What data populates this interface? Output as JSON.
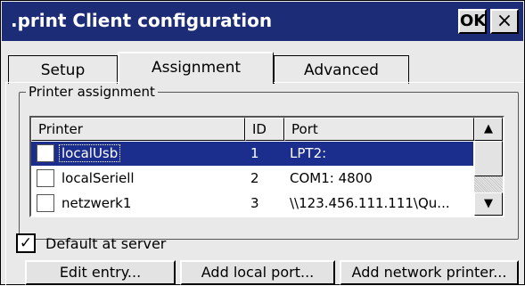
{
  "window": {
    "title": ".print Client configuration",
    "ok_label": "OK",
    "close_label": "×"
  },
  "tabs": [
    {
      "label": "Setup"
    },
    {
      "label": "Assignment"
    },
    {
      "label": "Advanced"
    }
  ],
  "group": {
    "label": "Printer assignment"
  },
  "list": {
    "columns": [
      "Printer",
      "ID",
      "Port"
    ],
    "rows": [
      {
        "printer": "localUsb",
        "id": "1",
        "port": "LPT2:",
        "checked": false,
        "selected": true
      },
      {
        "printer": "localSeriell",
        "id": "2",
        "port": "COM1: 4800",
        "checked": false,
        "selected": false
      },
      {
        "printer": "netzwerk1",
        "id": "3",
        "port": "\\\\123.456.111.111\\Qu...",
        "checked": false,
        "selected": false
      }
    ],
    "scroll_up": "▲",
    "scroll_down": "▼"
  },
  "default_at_server": {
    "label": "Default at server",
    "checked": true,
    "check_glyph": "✓"
  },
  "buttons": {
    "edit": "Edit entry...",
    "add_local": "Add local port...",
    "add_network": "Add network printer..."
  }
}
